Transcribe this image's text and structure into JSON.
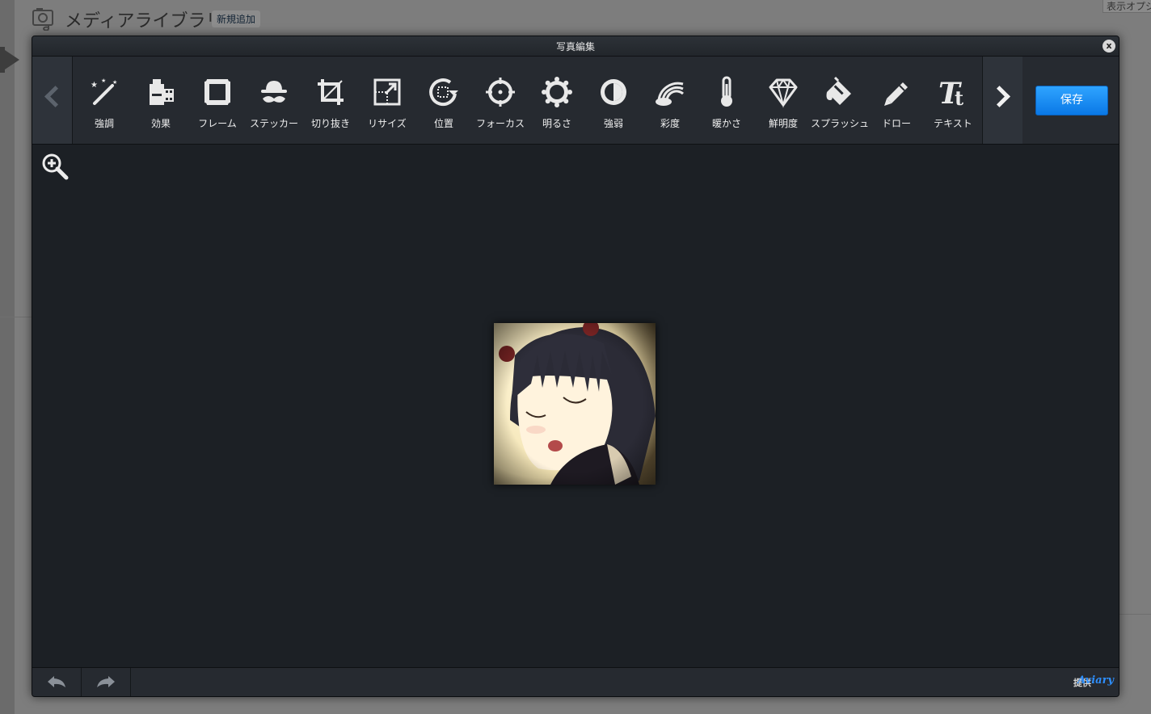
{
  "wp": {
    "page_title": "メディアライブラリ",
    "add_new": "新規追加",
    "screen_options": "表示オプション"
  },
  "editor": {
    "title": "写真編集",
    "close_label": "x",
    "save_label": "保存",
    "tools": [
      {
        "label": "強調",
        "icon": "magic-wand-icon"
      },
      {
        "label": "効果",
        "icon": "film-icon"
      },
      {
        "label": "フレーム",
        "icon": "frame-icon"
      },
      {
        "label": "ステッカー",
        "icon": "hat-mustache-icon"
      },
      {
        "label": "切り抜き",
        "icon": "crop-icon"
      },
      {
        "label": "リサイズ",
        "icon": "resize-icon"
      },
      {
        "label": "位置",
        "icon": "rotate-icon"
      },
      {
        "label": "フォーカス",
        "icon": "target-icon"
      },
      {
        "label": "明るさ",
        "icon": "sun-icon"
      },
      {
        "label": "強弱",
        "icon": "contrast-icon"
      },
      {
        "label": "彩度",
        "icon": "rainbow-icon"
      },
      {
        "label": "暖かさ",
        "icon": "thermometer-icon"
      },
      {
        "label": "鮮明度",
        "icon": "diamond-icon"
      },
      {
        "label": "スプラッシュ",
        "icon": "paint-bucket-icon"
      },
      {
        "label": "ドロー",
        "icon": "pencil-icon"
      },
      {
        "label": "テキスト",
        "icon": "text-icon"
      }
    ],
    "powered_by": "提供",
    "brand": "Aviary"
  },
  "colors": {
    "accent": "#1a8cff",
    "panel": "#262a30",
    "canvas": "#1c2025"
  }
}
